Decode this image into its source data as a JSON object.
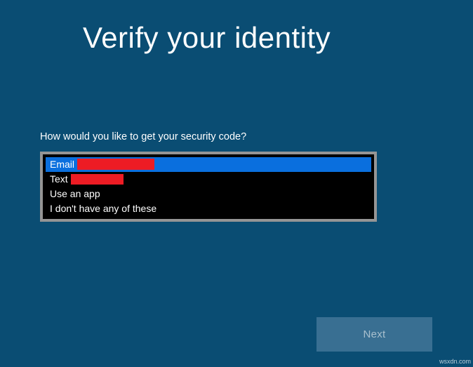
{
  "heading": "Verify your identity",
  "prompt": "How would you like to get your security code?",
  "options": [
    {
      "label": "Email ",
      "redacted": true,
      "selected": true
    },
    {
      "label": "Text ",
      "redacted": true,
      "selected": false
    },
    {
      "label": "Use an app",
      "redacted": false,
      "selected": false
    },
    {
      "label": "I don't have any of these",
      "redacted": false,
      "selected": false
    }
  ],
  "buttons": {
    "next": "Next"
  },
  "watermark": "wsxdn.com"
}
